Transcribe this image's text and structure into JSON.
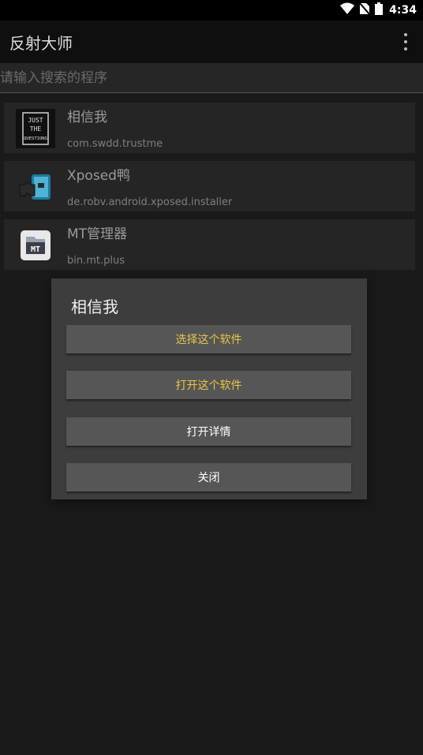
{
  "status_bar": {
    "time": "4:34",
    "icons": [
      "wifi-icon",
      "no-sim-icon",
      "battery-icon"
    ]
  },
  "app_bar": {
    "title": "反射大师",
    "overflow_icon": "more-vert-icon"
  },
  "search": {
    "placeholder": "请输入搜索的程序",
    "value": ""
  },
  "app_list": [
    {
      "name": "相信我",
      "package": "com.swdd.trustme",
      "icon": "just-the-questions-icon"
    },
    {
      "name": "Xposed鸭",
      "package": "de.robv.android.xposed.installer",
      "icon": "xposed-puzzle-icon"
    },
    {
      "name": "MT管理器",
      "package": "bin.mt.plus",
      "icon": "mt-manager-icon"
    }
  ],
  "dialog": {
    "title": "相信我",
    "buttons": [
      {
        "label": "选择这个软件",
        "color": "#e8c547"
      },
      {
        "label": "打开这个软件",
        "color": "#e8c547"
      },
      {
        "label": "打开详情",
        "color": "#ffffff"
      },
      {
        "label": "关闭",
        "color": "#ffffff"
      }
    ]
  },
  "icon_texts": {
    "just": "JUST",
    "the": "THE",
    "questions": "QUESTIONS",
    "mt": "MT"
  },
  "colors": {
    "background": "#1a1a1a",
    "app_bar": "#0f0f0f",
    "dialog": "#3d3d3d",
    "button": "#565656",
    "accent_text": "#e8c547"
  }
}
